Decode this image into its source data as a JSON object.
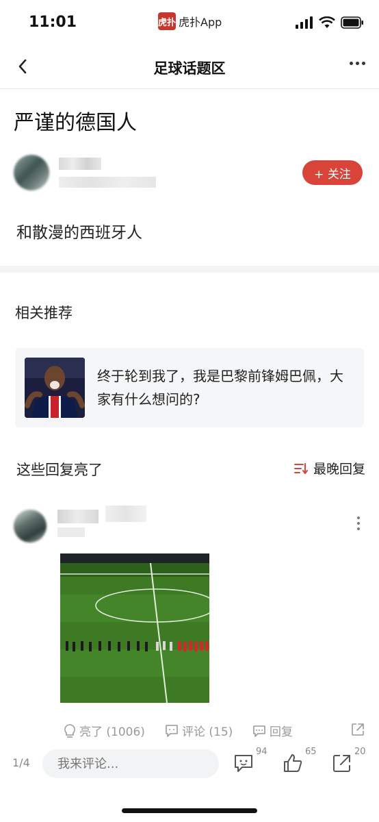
{
  "status_bar": {
    "time": "11:01",
    "app_logo": "虎扑",
    "app_name": "虎扑App"
  },
  "nav": {
    "title": "足球话题区"
  },
  "post": {
    "title": "严谨的德国人",
    "follow_label": "+ 关注",
    "body": "和散漫的西班牙人"
  },
  "related": {
    "title": "相关推荐",
    "card_text": "终于轮到我了，我是巴黎前锋姆巴佩，大家有什么想问的?"
  },
  "replies": {
    "title": "这些回复亮了",
    "sort_label": "最晚回复"
  },
  "reply_actions": {
    "light": "亮了 (1006)",
    "comment": "评论 (15)",
    "reply": "回复"
  },
  "bottom_bar": {
    "page": "1/4",
    "input_placeholder": "我来评论...",
    "comment_count": "94",
    "like_count": "65",
    "share_count": "20"
  },
  "colors": {
    "accent": "#d8433a",
    "logo": "#c8372d",
    "pitch": "#3f7a24"
  }
}
